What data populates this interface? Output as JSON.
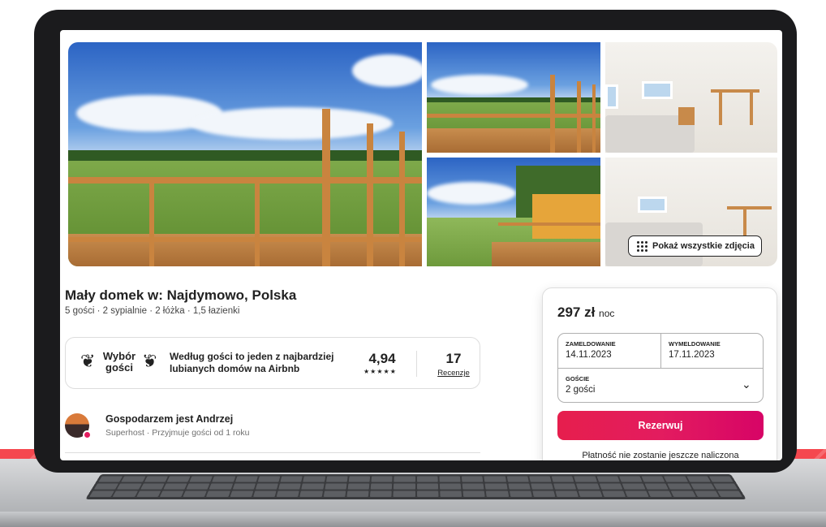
{
  "listing": {
    "title": "Mały domek w: Najdymowo, Polska",
    "details": "5 gości · 2 sypialnie · 2 łóżka · 1,5 łazienki"
  },
  "photos": {
    "show_all_label": "Pokaż wszystkie zdjęcia"
  },
  "guest_favorite": {
    "badge_line1": "Wybór",
    "badge_line2": "gości",
    "description": "Według gości to jeden z najbardziej lubianych domów na Airbnb",
    "rating": "4,94",
    "stars": "★★★★★",
    "reviews_count": "17",
    "reviews_label": "Recenzje"
  },
  "host": {
    "title": "Gospodarzem jest Andrzej",
    "subtitle": "Superhost · Przyjmuje gości od 1 roku"
  },
  "booking": {
    "price": "297 zł",
    "price_unit": "noc",
    "checkin_label": "ZAMELDOWANIE",
    "checkin_value": "14.11.2023",
    "checkout_label": "WYMELDOWANIE",
    "checkout_value": "17.11.2023",
    "guests_label": "GOŚCIE",
    "guests_value": "2 gości",
    "reserve_label": "Rezerwuj",
    "note": "Płatność nie zostanie jeszcze naliczona"
  },
  "colors": {
    "accent": "#e31c5f",
    "band": "#f5484f"
  }
}
